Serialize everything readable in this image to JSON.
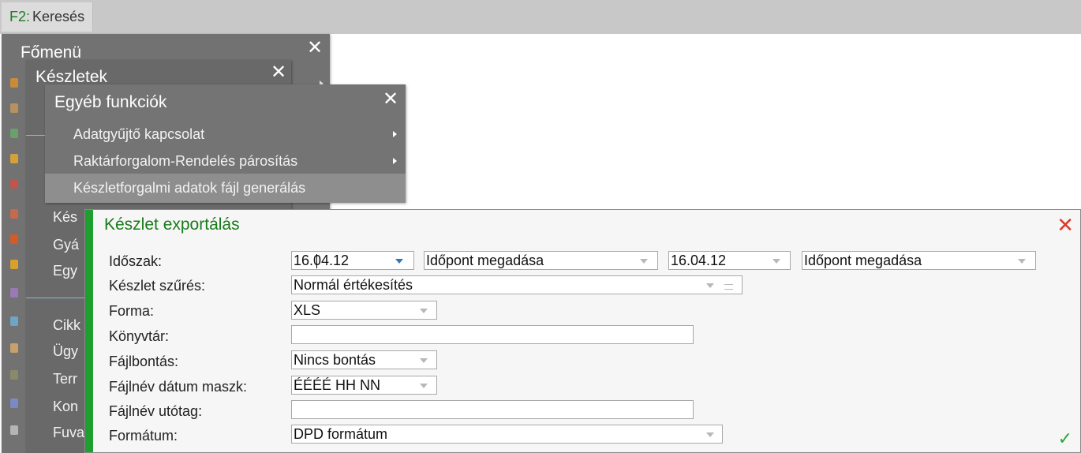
{
  "topbar": {
    "key": "F2",
    "label": "Keresés"
  },
  "main_menu": {
    "title": "Főmenü"
  },
  "stock_menu": {
    "title": "Készletek",
    "items": [
      {
        "label": "Kés"
      },
      {
        "label": "Gyá"
      },
      {
        "label": "Egy"
      },
      {
        "label": "Cikk"
      },
      {
        "label": "Ügy"
      },
      {
        "label": "Terr"
      },
      {
        "label": "Kon"
      },
      {
        "label": "Fuva"
      }
    ]
  },
  "other_menu": {
    "title": "Egyéb funkciók",
    "items": [
      {
        "label": "Adatgyűjtő kapcsolat"
      },
      {
        "label": "Raktárforgalom-Rendelés párosítás"
      },
      {
        "label": "Készletforgalmi adatok fájl generálás"
      }
    ]
  },
  "dialog": {
    "title": "Készlet exportálás",
    "period_label": "Időszak:",
    "date_from": "16.04.12",
    "time_from": "Időpont megadása",
    "date_to": "16.04.12",
    "time_to": "Időpont megadása",
    "filter_label": "Készlet szűrés:",
    "filter_value": "Normál értékesítés",
    "form_label": "Forma:",
    "form_value": "XLS",
    "dir_label": "Könyvtár:",
    "dir_value": "",
    "split_label": "Fájlbontás:",
    "split_value": "Nincs bontás",
    "mask_label": "Fájlnév dátum maszk:",
    "mask_value": "ÉÉÉÉ HH NN",
    "suffix_label": "Fájlnév utótag:",
    "suffix_value": "",
    "format_label": "Formátum:",
    "format_value": "DPD formátum"
  },
  "colors": {
    "accent_green": "#1e9e2c",
    "close_red": "#d83b2b",
    "menu_gray": "#6f6f6f"
  }
}
